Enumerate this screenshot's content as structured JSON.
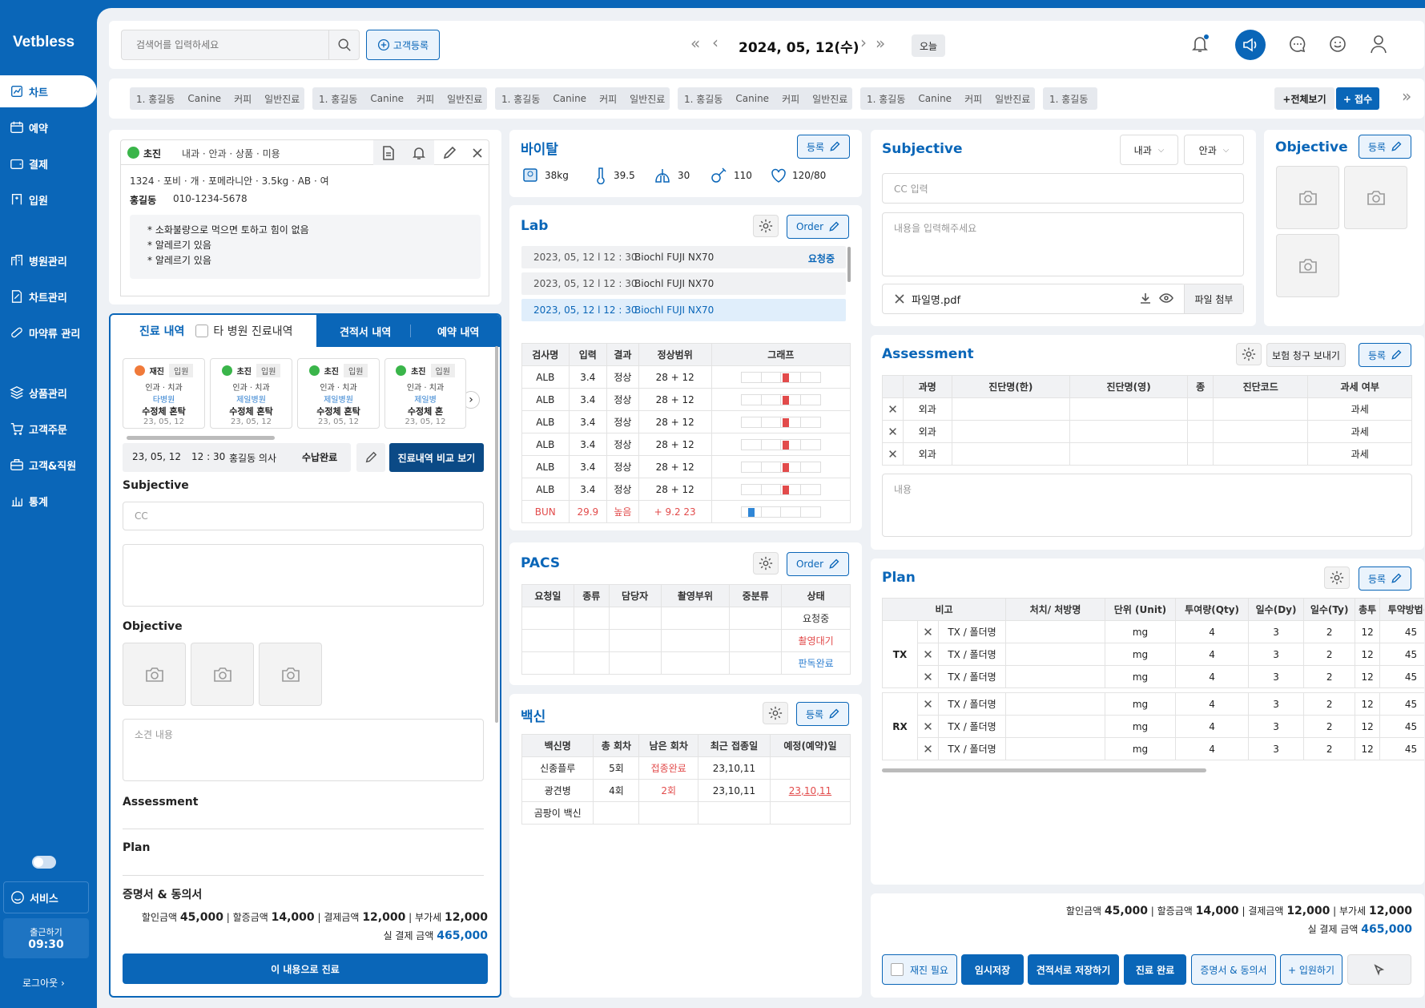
{
  "app": {
    "logo": "Vetbless",
    "today_btn": "오늘",
    "date": "2024, 05, 12(수)",
    "search_placeholder": "검색어를 입력하세요",
    "register_btn": "고객등록"
  },
  "sidebar": {
    "items": [
      {
        "label": "차트",
        "icon": "chart-icon"
      },
      {
        "label": "예약",
        "icon": "calendar-icon"
      },
      {
        "label": "결제",
        "icon": "wallet-icon"
      },
      {
        "label": "입원",
        "icon": "hospital-icon"
      },
      {
        "label": "병원관리",
        "icon": "building-icon"
      },
      {
        "label": "차트관리",
        "icon": "edit-doc-icon"
      },
      {
        "label": "마약류 관리",
        "icon": "pill-icon"
      },
      {
        "label": "상품관리",
        "icon": "layers-icon"
      },
      {
        "label": "고객주문",
        "icon": "cart-icon"
      },
      {
        "label": "고객&직원",
        "icon": "briefcase-icon"
      },
      {
        "label": "통계",
        "icon": "bar-chart-icon"
      }
    ],
    "service": "서비스",
    "clockin_label": "출근하기",
    "clockin_time": "09:30",
    "logout": "로그아웃"
  },
  "queue": {
    "chips": [
      [
        "1. 홍길동",
        "Canine",
        "커피",
        "일반진료"
      ],
      [
        "1. 홍길동",
        "Canine",
        "커피",
        "일반진료"
      ],
      [
        "1. 홍길동",
        "Canine",
        "커피",
        "일반진료"
      ],
      [
        "1. 홍길동",
        "Canine",
        "커피",
        "일반진료"
      ],
      [
        "1. 홍길동",
        "Canine",
        "커피",
        "일반진료"
      ],
      [
        "1. 홍길동"
      ]
    ],
    "view_all": "+전체보기",
    "accept": "+ 접수"
  },
  "patient": {
    "status": "초진",
    "depts": "내과 · 안과 · 상품 · 미용",
    "info": "1324 · 포비 · 개 · 포메라니안 · 3.5kg · AB · 여",
    "owner": "홍길동",
    "phone": "010-1234-5678",
    "notes": [
      "* 소화불량으로 먹으면 토하고 힘이 없음",
      "* 알레르기 있음",
      "* 알레르기 있음"
    ]
  },
  "history": {
    "tabs": [
      "진료 내역",
      "타 병원 진료내역",
      "견적서 내역",
      "예약 내역"
    ],
    "cards": [
      {
        "status": "재진",
        "type": "입원",
        "dept": "인과 · 치과",
        "hosp": "타병원",
        "title": "수정체 혼탁",
        "date": "23, 05, 12",
        "color": "#f07a3a"
      },
      {
        "status": "초진",
        "type": "입원",
        "dept": "인과 · 치과",
        "hosp": "제일병원",
        "title": "수정체 혼탁",
        "date": "23, 05, 12",
        "color": "#3ab54a"
      },
      {
        "status": "초진",
        "type": "입원",
        "dept": "인과 · 치과",
        "hosp": "제일병원",
        "title": "수정체 혼탁",
        "date": "23, 05, 12",
        "color": "#3ab54a"
      },
      {
        "status": "초진",
        "type": "입원",
        "dept": "인과 · 치과",
        "hosp": "제일병",
        "title": "수정체 혼",
        "date": "23, 05, 12",
        "color": "#3ab54a"
      }
    ],
    "detail_date": "23, 05, 12",
    "detail_time": "12 : 30",
    "detail_doctor": "홍길동 의사",
    "paid": "수납완료",
    "compare_btn": "진료내역 비교 보기",
    "subjective": "Subjective",
    "cc_placeholder": "CC",
    "objective": "Objective",
    "opinion_placeholder": "소견 내용",
    "assessment": "Assessment",
    "plan": "Plan",
    "consent": "증명서 & 동의서",
    "totals": {
      "disc_l": "할인금액",
      "disc": "45,000",
      "sur_l": "할증금액",
      "sur": "14,000",
      "pay_l": "결제금액",
      "pay": "12,000",
      "vat_l": "부가세",
      "vat": "12,000",
      "real_l": "실 결제 금액",
      "real": "465,000"
    },
    "submit": "이 내용으로 진료"
  },
  "vital": {
    "title": "바이탈",
    "register": "등록",
    "weight": "38kg",
    "temp": "39.5",
    "resp": "30",
    "pulse": "110",
    "bp": "120/80"
  },
  "lab": {
    "title": "Lab",
    "order": "Order",
    "requests": [
      {
        "dt": "2023, 05, 12 l 12 : 30",
        "dev": "Biochl FUJI NX70",
        "st": "요청중"
      },
      {
        "dt": "2023, 05, 12 l 12 : 30",
        "dev": "Biochl FUJI NX70",
        "st": ""
      },
      {
        "dt": "2023, 05, 12 l 12 : 30",
        "dev": "Biochl FUJI NX70",
        "st": ""
      }
    ],
    "headers": [
      "검사명",
      "입력",
      "결과",
      "정상범위",
      "그래프"
    ],
    "rows": [
      {
        "name": "ALB",
        "val": "3.4",
        "res": "정상",
        "range": "28 + 12",
        "level": 0.55
      },
      {
        "name": "ALB",
        "val": "3.4",
        "res": "정상",
        "range": "28 + 12",
        "level": 0.55
      },
      {
        "name": "ALB",
        "val": "3.4",
        "res": "정상",
        "range": "28 + 12",
        "level": 0.55
      },
      {
        "name": "ALB",
        "val": "3.4",
        "res": "정상",
        "range": "28 + 12",
        "level": 0.55
      },
      {
        "name": "ALB",
        "val": "3.4",
        "res": "정상",
        "range": "28 + 12",
        "level": 0.55
      },
      {
        "name": "ALB",
        "val": "3.4",
        "res": "정상",
        "range": "28 + 12",
        "level": 0.55
      },
      {
        "name": "BUN",
        "val": "29.9",
        "res": "높음",
        "range": "+ 9.2 23",
        "level": 0.12
      }
    ]
  },
  "pacs": {
    "title": "PACS",
    "order": "Order",
    "headers": [
      "요청일",
      "종류",
      "담당자",
      "촬영부위",
      "중분류",
      "상태"
    ],
    "statuses": [
      "요청중",
      "촬영대기",
      "판독완료"
    ]
  },
  "vaccine": {
    "title": "백신",
    "register": "등록",
    "headers": [
      "백신명",
      "총 회차",
      "남은 회차",
      "최근 접종일",
      "예정(예약)일"
    ],
    "rows": [
      [
        "신종플루",
        "5회",
        "접종완료",
        "23,10,11",
        ""
      ],
      [
        "광견병",
        "4회",
        "2회",
        "23,10,11",
        "23,10,11"
      ],
      [
        "곰팡이 백신",
        "",
        "",
        "",
        ""
      ]
    ]
  },
  "subjective": {
    "title": "Subjective",
    "dept1": "내과",
    "dept2": "안과",
    "cc_placeholder": "CC 입력",
    "content_placeholder": "내용을 입력해주세요",
    "file": "파일명.pdf",
    "attach": "파일 첨부"
  },
  "objective": {
    "title": "Objective",
    "register": "등록"
  },
  "assessment": {
    "title": "Assessment",
    "insurance": "보험 청구 보내기",
    "register": "등록",
    "headers": [
      "과명",
      "진단명(한)",
      "진단명(영)",
      "종",
      "진단코드",
      "과세 여부"
    ],
    "rows": [
      [
        "외과",
        "과세"
      ],
      [
        "외과",
        "과세"
      ],
      [
        "외과",
        "과세"
      ]
    ],
    "content_placeholder": "내용"
  },
  "plan": {
    "title": "Plan",
    "register": "등록",
    "headers": [
      "비고",
      "처치/ 처방명",
      "단위 (Unit)",
      "투여량(Qty)",
      "일수(Dy)",
      "일수(Ty)",
      "총투",
      "투약방법(F"
    ],
    "groups": [
      {
        "label": "TX",
        "rows": [
          [
            "TX / 폴더명",
            "mg",
            "4",
            "3",
            "2",
            "12",
            "45"
          ],
          [
            "TX / 폴더명",
            "mg",
            "4",
            "3",
            "2",
            "12",
            "45"
          ],
          [
            "TX / 폴더명",
            "mg",
            "4",
            "3",
            "2",
            "12",
            "45"
          ]
        ]
      },
      {
        "label": "RX",
        "rows": [
          [
            "TX / 폴더명",
            "mg",
            "4",
            "3",
            "2",
            "12",
            "45"
          ],
          [
            "TX / 폴더명",
            "mg",
            "4",
            "3",
            "2",
            "12",
            "45"
          ],
          [
            "TX / 폴더명",
            "mg",
            "4",
            "3",
            "2",
            "12",
            "45"
          ]
        ]
      }
    ]
  },
  "footer": {
    "totals": {
      "disc_l": "할인금액",
      "disc": "45,000",
      "sur_l": "할증금액",
      "sur": "14,000",
      "pay_l": "결제금액",
      "pay": "12,000",
      "vat_l": "부가세",
      "vat": "12,000",
      "real_l": "실 결제 금액",
      "real": "465,000"
    },
    "revisit": "재진 필요",
    "temp_save": "임시저장",
    "estimate": "견적서로 저장하기",
    "done": "진료 완료",
    "cert": "증명서 & 동의서",
    "admit": "+ 입원하기"
  },
  "colors": {
    "primary": "#0a66b8",
    "danger": "#e24b4b",
    "ok": "#3ab54a"
  }
}
